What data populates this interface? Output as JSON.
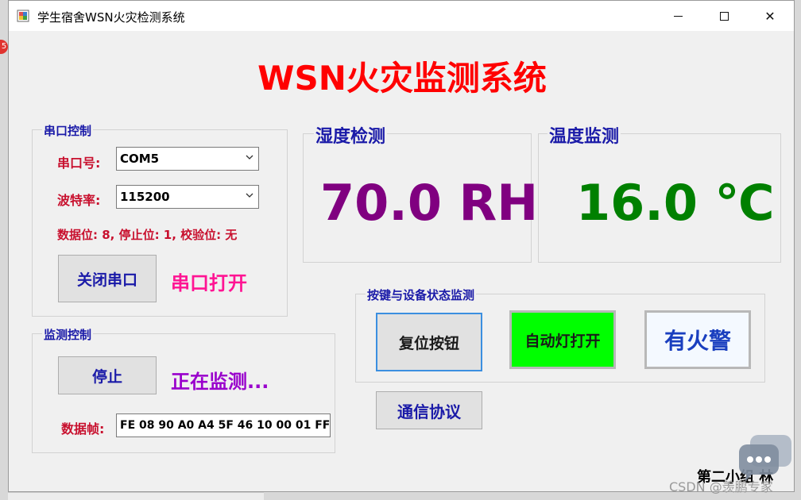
{
  "window": {
    "title": "学生宿舍WSN火灾检测系统"
  },
  "titlebar_buttons": {
    "minimize": "minimize-icon",
    "maximize": "maximize-icon",
    "close": "✕"
  },
  "main_title": "WSN火灾监测系统",
  "serial_group": {
    "title": "串口控制",
    "port_label": "串口号:",
    "port_value": "COM5",
    "baud_label": "波特率:",
    "baud_value": "115200",
    "params_text": "数据位: 8, 停止位: 1, 校验位: 无",
    "toggle_button": "关闭串口",
    "status_text": "串口打开"
  },
  "monitor_group": {
    "title": "监测控制",
    "stop_button": "停止",
    "status_text": "正在监测...",
    "frame_label": "数据帧:",
    "frame_value": "FE 08 90 A0 A4 5F 46 10 00 01 FF"
  },
  "humidity": {
    "title": "湿度检测",
    "value": "70.0 RH",
    "color": "#800080"
  },
  "temperature": {
    "title": "温度监测",
    "value": "16.0  ℃",
    "color": "#008000"
  },
  "device_group": {
    "title": "按键与设备状态监测",
    "reset_button": "复位按钮",
    "light_button": "自动灯打开",
    "light_color": "#00ff00",
    "fire_button": "有火警"
  },
  "protocol_button": "通信协议",
  "footer_text": "第二小组   林",
  "watermark": "CSDN @羡鹏专家",
  "notification_badge": "5"
}
